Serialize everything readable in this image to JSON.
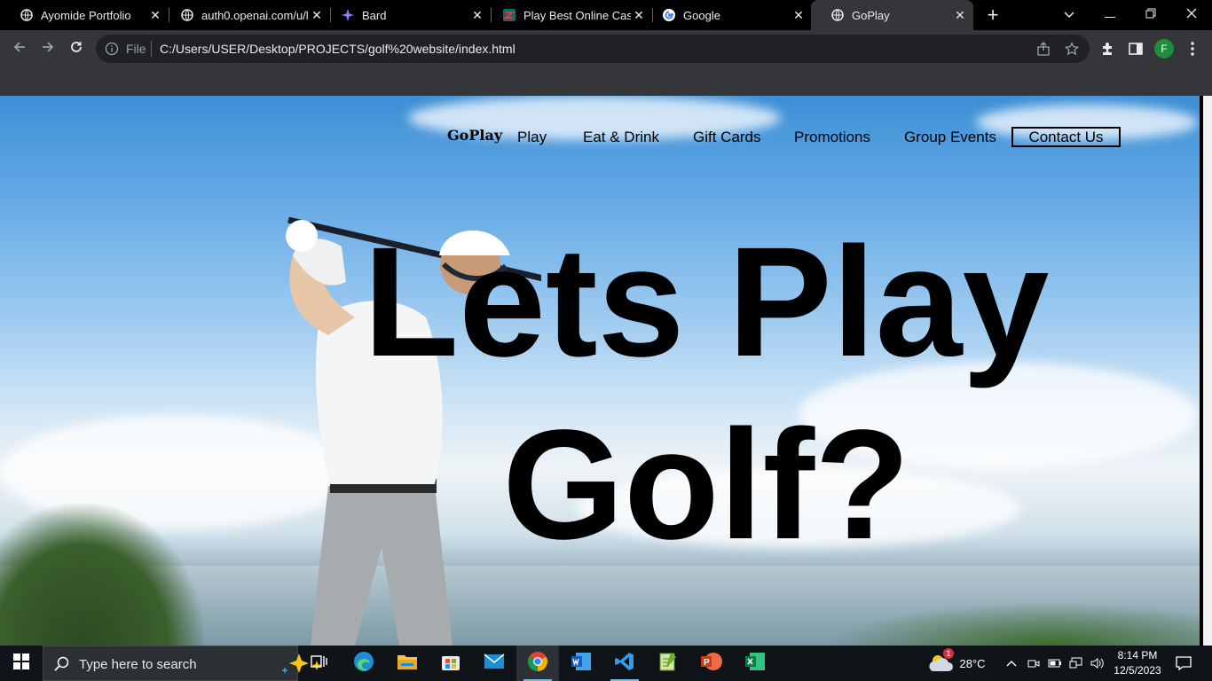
{
  "browser": {
    "tabs": [
      {
        "title": "Ayomide Portfolio",
        "icon": "globe-icon"
      },
      {
        "title": "auth0.openai.com/u/l",
        "icon": "globe-icon"
      },
      {
        "title": "Bard",
        "icon": "bard-icon"
      },
      {
        "title": "Play Best Online Casi",
        "icon": "casino-icon"
      },
      {
        "title": "Google",
        "icon": "google-icon"
      },
      {
        "title": "GoPlay",
        "icon": "globe-icon",
        "active": true
      }
    ],
    "address": {
      "scheme_label": "File",
      "url": "C:/Users/USER/Desktop/PROJECTS/golf%20website/index.html"
    },
    "profile_initial": "F"
  },
  "site": {
    "logo": "GoPlay",
    "nav": [
      "Play",
      "Eat & Drink",
      "Gift Cards",
      "Promotions",
      "Group Events"
    ],
    "contact": "Contact Us",
    "hero_line1": "Lets Play",
    "hero_line2": "Golf?"
  },
  "taskbar": {
    "search_placeholder": "Type here to search",
    "weather_temp": "28°C",
    "weather_badge": "1",
    "time": "8:14 PM",
    "date": "12/5/2023",
    "apps": [
      "task-view",
      "edge",
      "file-explorer",
      "microsoft-store",
      "mail",
      "chrome",
      "word",
      "vscode",
      "notepad-plus-plus",
      "powerpoint",
      "excel"
    ]
  },
  "colors": {
    "tabstrip": "#000000",
    "toolbar": "#35363a",
    "omnibox": "#202124",
    "taskbar": "#101418",
    "accent_running": "#76b9ed",
    "profile": "#1e8e3e"
  }
}
